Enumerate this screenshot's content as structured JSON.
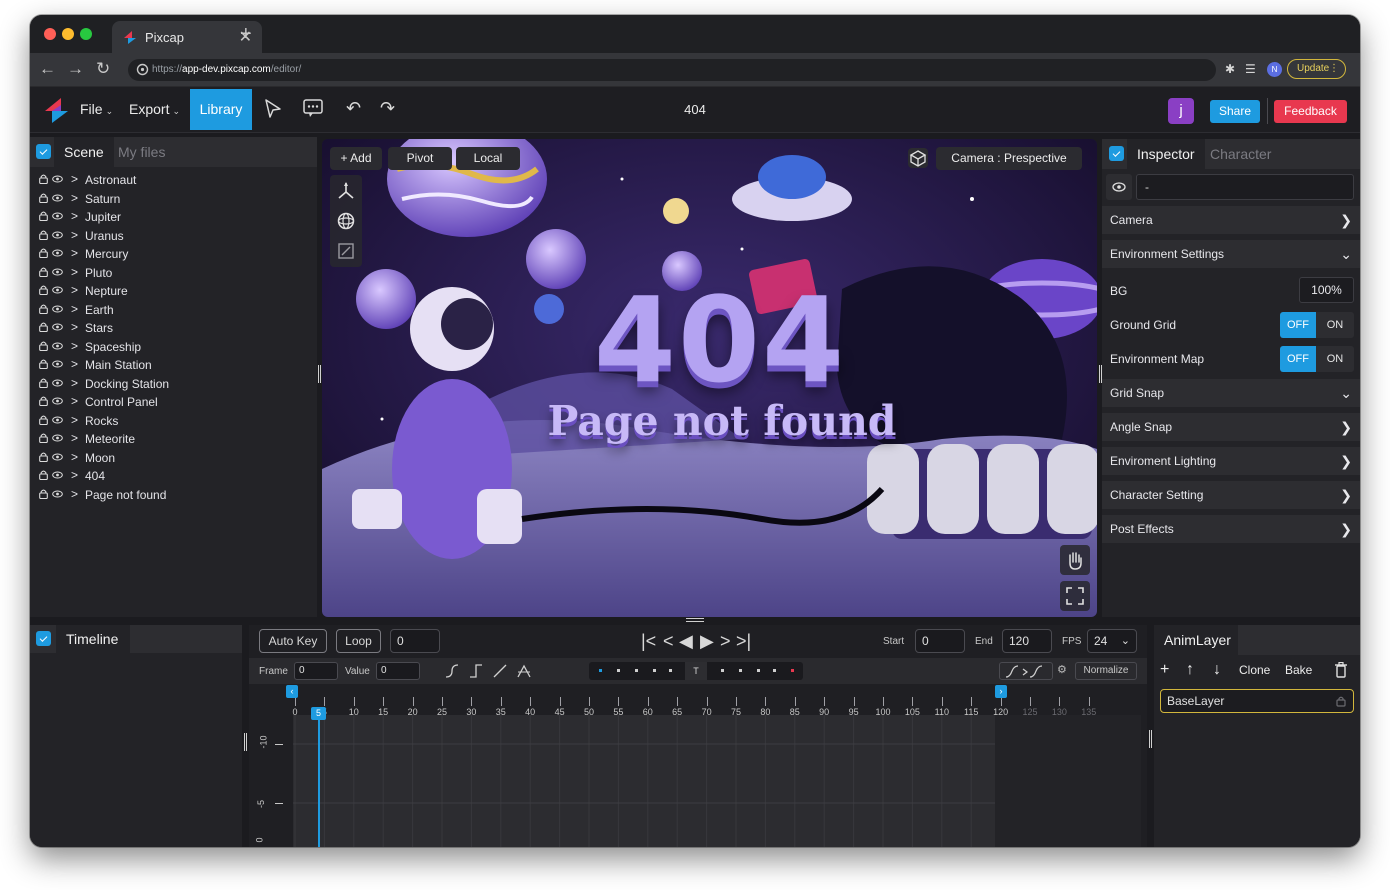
{
  "browser": {
    "tab_title": "Pixcap",
    "url_scheme": "https://",
    "url_host": "app-dev.pixcap.com",
    "url_path": "/editor/",
    "profile_initial": "N",
    "update_label": "Update"
  },
  "toolbar": {
    "menu_file": "File",
    "menu_export": "Export",
    "library_label": "Library",
    "doc_title": "404",
    "user_initial": "j",
    "share_label": "Share",
    "feedback_label": "Feedback",
    "accent": "#1e9be0",
    "danger": "#e8384f"
  },
  "scene": {
    "tab_active": "Scene",
    "tab_inactive": "My files",
    "items": [
      "Astronaut",
      "Saturn",
      "Jupiter",
      "Uranus",
      "Mercury",
      "Pluto",
      "Nepture",
      "Earth",
      "Stars",
      "Spaceship",
      "Main Station",
      "Docking Station",
      "Control Panel",
      "Rocks",
      "Meteorite",
      "Moon",
      "404",
      "Page not found"
    ]
  },
  "viewport": {
    "add_label": "Add",
    "pivot_label": "Pivot",
    "local_label": "Local",
    "camera_label": "Camera : Prespective",
    "headline": "404",
    "subline": "Page not found"
  },
  "inspector": {
    "tab_active": "Inspector",
    "tab_inactive": "Character",
    "name_value": "-",
    "camera": "Camera",
    "environment_settings": "Environment Settings",
    "bg_label": "BG",
    "bg_value": "100%",
    "ground_grid": "Ground Grid",
    "environment_map": "Environment Map",
    "off_label": "OFF",
    "on_label": "ON",
    "grid_snap": "Grid Snap",
    "angle_snap": "Angle Snap",
    "enviroment_lighting": "Enviroment Lighting",
    "character_setting": "Character Setting",
    "post_effects": "Post Effects"
  },
  "timeline": {
    "title": "Timeline",
    "auto_key": "Auto Key",
    "loop": "Loop",
    "current_frame": "0",
    "start_label": "Start",
    "start_value": "0",
    "end_label": "End",
    "end_value": "120",
    "fps_label": "FPS",
    "fps_value": "24",
    "frame_label": "Frame",
    "frame_value": "0",
    "value_label": "Value",
    "value_value": "0",
    "key_marker": "T",
    "normalize_label": "Normalize",
    "playhead_frame": "5",
    "ticks": [
      "0",
      "5",
      "10",
      "15",
      "20",
      "25",
      "30",
      "35",
      "40",
      "45",
      "50",
      "55",
      "60",
      "65",
      "70",
      "75",
      "80",
      "85",
      "90",
      "95",
      "100",
      "105",
      "110",
      "115",
      "120",
      "125",
      "130",
      "135"
    ],
    "y_labels": [
      "-10",
      "-5",
      "0"
    ]
  },
  "animlayer": {
    "title": "AnimLayer",
    "clone_label": "Clone",
    "bake_label": "Bake",
    "layer_name": "BaseLayer"
  }
}
